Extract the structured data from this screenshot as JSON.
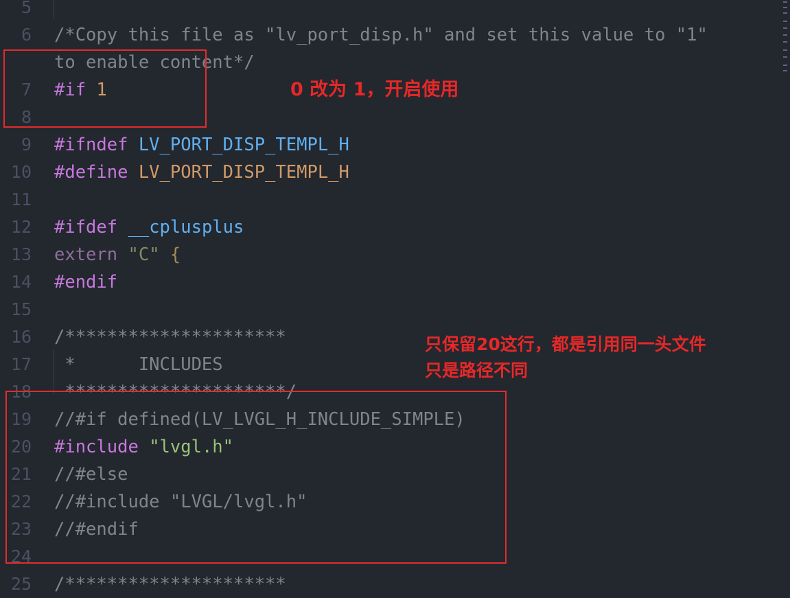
{
  "editor": {
    "lines": [
      {
        "num": "5",
        "tokens": []
      },
      {
        "num": "6",
        "tokens": [
          {
            "t": "/*Copy this file as \"lv_port_disp.h\" and set this value to \"1\"",
            "c": "comment"
          }
        ]
      },
      {
        "num": "",
        "tokens": [
          {
            "t": "to enable content*/",
            "c": "comment"
          }
        ]
      },
      {
        "num": "7",
        "tokens": [
          {
            "t": "#if",
            "c": "keyword"
          },
          {
            "t": " ",
            "c": "plain"
          },
          {
            "t": "1",
            "c": "number"
          }
        ]
      },
      {
        "num": "8",
        "tokens": []
      },
      {
        "num": "9",
        "tokens": [
          {
            "t": "#ifndef",
            "c": "keyword"
          },
          {
            "t": " ",
            "c": "plain"
          },
          {
            "t": "LV_PORT_DISP_TEMPL_H",
            "c": "macro"
          }
        ]
      },
      {
        "num": "10",
        "tokens": [
          {
            "t": "#define",
            "c": "keyword"
          },
          {
            "t": " ",
            "c": "plain"
          },
          {
            "t": "LV_PORT_DISP_TEMPL_H",
            "c": "constant"
          }
        ]
      },
      {
        "num": "11",
        "tokens": []
      },
      {
        "num": "12",
        "tokens": [
          {
            "t": "#ifdef",
            "c": "keyword"
          },
          {
            "t": " ",
            "c": "plain"
          },
          {
            "t": "__cplusplus",
            "c": "macro"
          }
        ]
      },
      {
        "num": "13",
        "tokens": [
          {
            "t": "extern",
            "c": "dimkw"
          },
          {
            "t": " ",
            "c": "plain"
          },
          {
            "t": "\"C\"",
            "c": "dimstring"
          },
          {
            "t": " ",
            "c": "plain"
          },
          {
            "t": "{",
            "c": "bracket"
          }
        ]
      },
      {
        "num": "14",
        "tokens": [
          {
            "t": "#endif",
            "c": "keyword"
          }
        ]
      },
      {
        "num": "15",
        "tokens": []
      },
      {
        "num": "16",
        "tokens": [
          {
            "t": "/*********************",
            "c": "comment"
          }
        ]
      },
      {
        "num": "17",
        "tokens": [
          {
            "t": " *      INCLUDES",
            "c": "comment"
          }
        ]
      },
      {
        "num": "18",
        "tokens": [
          {
            "t": " *********************/",
            "c": "comment"
          }
        ]
      },
      {
        "num": "19",
        "tokens": [
          {
            "t": "//#if defined(LV_LVGL_H_INCLUDE_SIMPLE)",
            "c": "comment"
          }
        ]
      },
      {
        "num": "20",
        "tokens": [
          {
            "t": "#include",
            "c": "keyword"
          },
          {
            "t": " ",
            "c": "plain"
          },
          {
            "t": "\"lvgl.h\"",
            "c": "string"
          }
        ]
      },
      {
        "num": "21",
        "tokens": [
          {
            "t": "//#else",
            "c": "comment"
          }
        ]
      },
      {
        "num": "22",
        "tokens": [
          {
            "t": "//#include \"LVGL/lvgl.h\"",
            "c": "comment"
          }
        ]
      },
      {
        "num": "23",
        "tokens": [
          {
            "t": "//#endif",
            "c": "comment"
          }
        ]
      },
      {
        "num": "24",
        "tokens": []
      },
      {
        "num": "25",
        "tokens": [
          {
            "t": "/*********************",
            "c": "comment"
          }
        ]
      }
    ]
  },
  "annotations": {
    "note1": "0 改为 1，开启使用",
    "note2_line1": "只保留20这行，都是引用同一头文件",
    "note2_line2": "只是路径不同"
  },
  "colors": {
    "background": "#23272e",
    "line_number": "#495162",
    "keyword": "#c678dd",
    "macro": "#61afef",
    "constant": "#d19a66",
    "number": "#d19a66",
    "string": "#98c379",
    "comment": "#7f848e",
    "annotation": "#e02d2d"
  }
}
